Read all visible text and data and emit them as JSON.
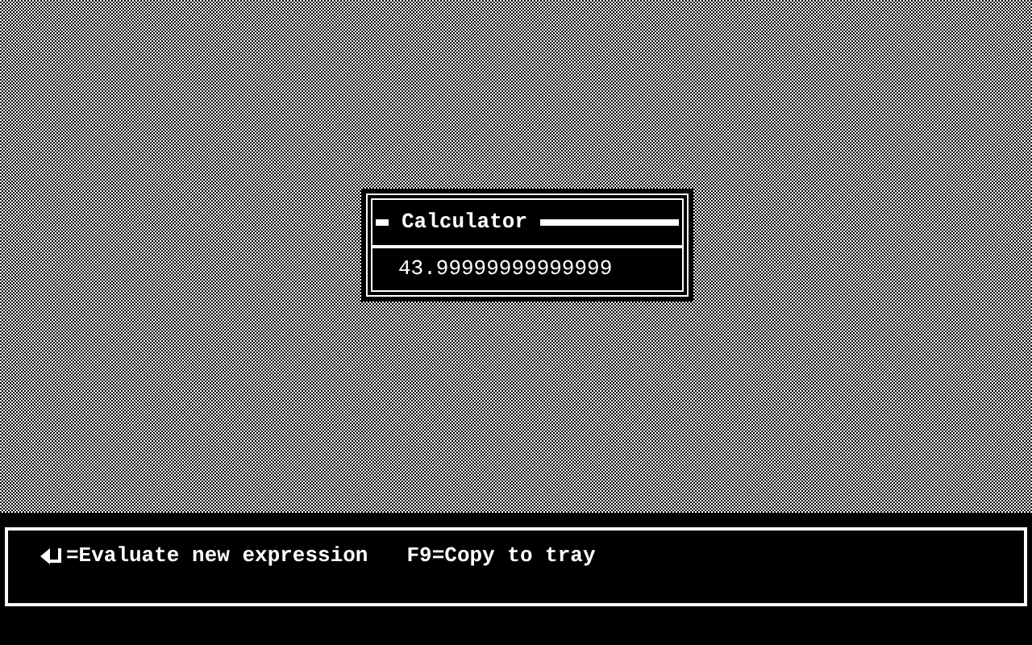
{
  "dialog": {
    "title": "Calculator",
    "value": "43.99999999999999"
  },
  "hints": [
    {
      "kind": "enter",
      "text": "=Evaluate new expression"
    },
    {
      "kind": "plain",
      "text": "F9=Copy to tray"
    }
  ]
}
